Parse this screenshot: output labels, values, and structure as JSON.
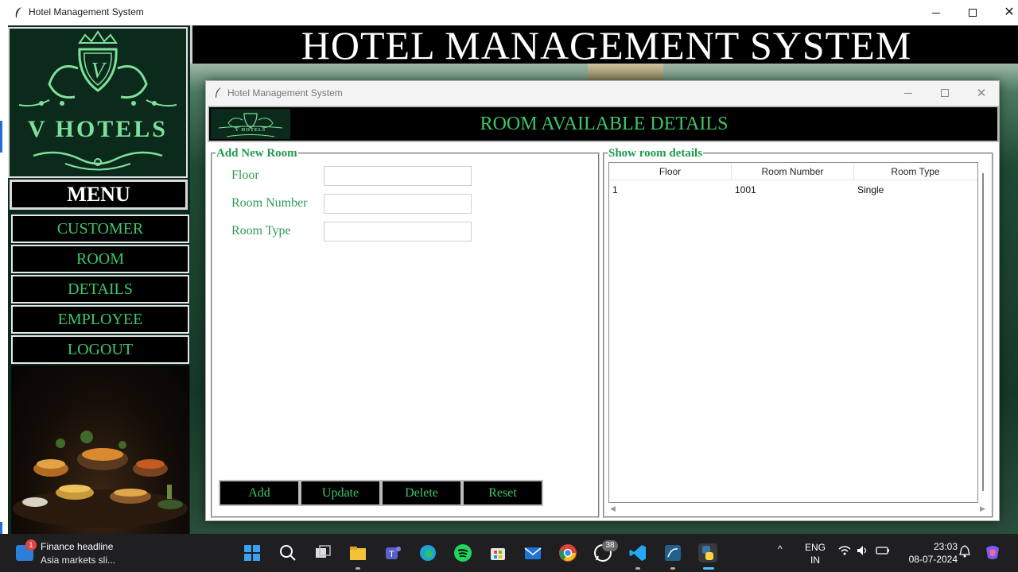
{
  "window": {
    "title": "Hotel Management System",
    "controls": {
      "minimize": "—",
      "maximize": "☐",
      "close": "✕"
    }
  },
  "logo": {
    "letter": "V",
    "name": "V HOTELS"
  },
  "banner": {
    "title": "HOTEL MANAGEMENT SYSTEM"
  },
  "menu": {
    "title": "MENU",
    "items": [
      "CUSTOMER",
      "ROOM",
      "DETAILS",
      "EMPLOYEE",
      "LOGOUT"
    ]
  },
  "child_window": {
    "title": "Hotel Management System",
    "banner_title": "ROOM AVAILABLE DETAILS",
    "logo_name": "V HOTELS"
  },
  "form": {
    "frame_title": "Add New Room",
    "fields": [
      {
        "label": "Floor",
        "value": ""
      },
      {
        "label": "Room Number",
        "value": ""
      },
      {
        "label": "Room Type",
        "value": ""
      }
    ],
    "buttons": [
      "Add",
      "Update",
      "Delete",
      "Reset"
    ]
  },
  "table": {
    "frame_title": "Show room details",
    "columns": [
      "Floor",
      "Room Number",
      "Room Type"
    ],
    "rows": [
      [
        "1",
        "1001",
        "Single"
      ]
    ]
  },
  "taskbar": {
    "news_badge": "1",
    "news_headline": "Finance headline",
    "news_subtext": "Asia markets sli...",
    "whatsapp_badge": "38",
    "lang_line1": "ENG",
    "lang_line2": "IN",
    "time": "23:03",
    "date": "08-07-2024"
  },
  "colors": {
    "accent_green": "#3bc76a",
    "logo_green": "#7fe09a",
    "dark_bg": "#0b2a1c",
    "button_bg": "#000000"
  }
}
